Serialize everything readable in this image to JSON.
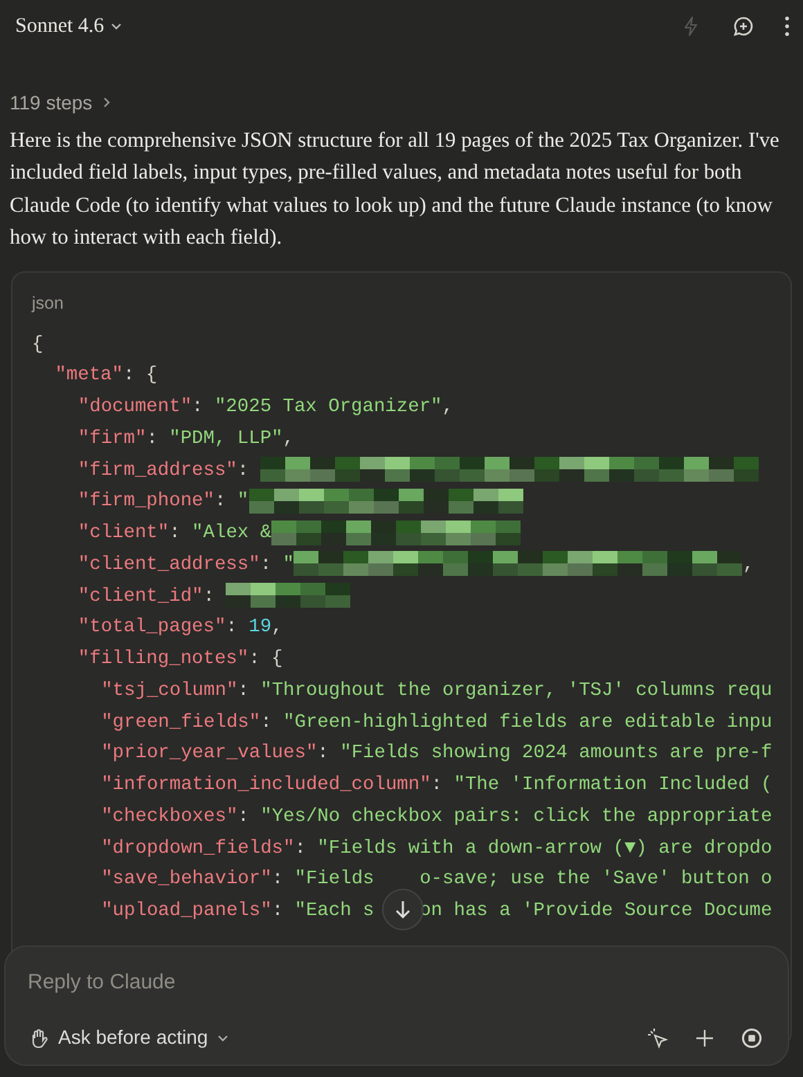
{
  "header": {
    "model": "Sonnet 4.6",
    "actions": [
      {
        "kind": "bolt",
        "disabled": true
      },
      {
        "kind": "new-chat",
        "disabled": false
      },
      {
        "kind": "more",
        "disabled": false
      }
    ]
  },
  "steps": {
    "label": "119 steps",
    "expanded": false
  },
  "message": "Here is the comprehensive JSON structure for all 19 pages of the 2025 Tax Organizer. I've included field labels, input types, pre-filled values, and metadata notes useful for both Claude Code (to identify what values to look up) and the future Claude instance (to know how to interact with each field).",
  "code_block": {
    "language": "json",
    "lines": [
      {
        "tokens": [
          {
            "kind": "punct",
            "text": "{"
          }
        ],
        "children": [
          {
            "tokens": [
              {
                "kind": "key",
                "text": "\"meta\""
              },
              {
                "kind": "punct",
                "text": ": {"
              }
            ],
            "children": [
              {
                "tokens": [
                  {
                    "kind": "key",
                    "text": "\"document\""
                  },
                  {
                    "kind": "punct",
                    "text": ": "
                  },
                  {
                    "kind": "string",
                    "text": "\"2025 Tax Organizer\""
                  },
                  {
                    "kind": "punct",
                    "text": ","
                  }
                ]
              },
              {
                "tokens": [
                  {
                    "kind": "key",
                    "text": "\"firm\""
                  },
                  {
                    "kind": "punct",
                    "text": ": "
                  },
                  {
                    "kind": "string",
                    "text": "\"PDM, LLP\""
                  },
                  {
                    "kind": "punct",
                    "text": ","
                  }
                ]
              },
              {
                "tokens": [
                  {
                    "kind": "key",
                    "text": "\"firm_address\""
                  },
                  {
                    "kind": "punct",
                    "text": ": "
                  },
                  {
                    "kind": "redacted"
                  }
                ]
              },
              {
                "tokens": [
                  {
                    "kind": "key",
                    "text": "\"firm_phone\""
                  },
                  {
                    "kind": "punct",
                    "text": ": "
                  },
                  {
                    "kind": "string",
                    "text": "\""
                  },
                  {
                    "kind": "redacted"
                  }
                ]
              },
              {
                "tokens": [
                  {
                    "kind": "key",
                    "text": "\"client\""
                  },
                  {
                    "kind": "punct",
                    "text": ": "
                  },
                  {
                    "kind": "string",
                    "text": "\"Alex &"
                  },
                  {
                    "kind": "redacted"
                  }
                ]
              },
              {
                "tokens": [
                  {
                    "kind": "key",
                    "text": "\"client_address\""
                  },
                  {
                    "kind": "punct",
                    "text": ": "
                  },
                  {
                    "kind": "string",
                    "text": "\""
                  },
                  {
                    "kind": "redacted"
                  },
                  {
                    "kind": "punct",
                    "text": ","
                  }
                ]
              },
              {
                "tokens": [
                  {
                    "kind": "key",
                    "text": "\"client_id\""
                  },
                  {
                    "kind": "punct",
                    "text": ": "
                  },
                  {
                    "kind": "redacted"
                  }
                ]
              },
              {
                "tokens": [
                  {
                    "kind": "key",
                    "text": "\"total_pages\""
                  },
                  {
                    "kind": "punct",
                    "text": ": "
                  },
                  {
                    "kind": "number",
                    "text": "19"
                  },
                  {
                    "kind": "punct",
                    "text": ","
                  }
                ]
              },
              {
                "tokens": [
                  {
                    "kind": "key",
                    "text": "\"filling_notes\""
                  },
                  {
                    "kind": "punct",
                    "text": ": {"
                  }
                ],
                "children": [
                  {
                    "tokens": [
                      {
                        "kind": "key",
                        "text": "\"tsj_column\""
                      },
                      {
                        "kind": "punct",
                        "text": ": "
                      },
                      {
                        "kind": "string",
                        "text": "\"Throughout the organizer, 'TSJ' columns requ"
                      }
                    ]
                  },
                  {
                    "tokens": [
                      {
                        "kind": "key",
                        "text": "\"green_fields\""
                      },
                      {
                        "kind": "punct",
                        "text": ": "
                      },
                      {
                        "kind": "string",
                        "text": "\"Green-highlighted fields are editable inpu"
                      }
                    ]
                  },
                  {
                    "tokens": [
                      {
                        "kind": "key",
                        "text": "\"prior_year_values\""
                      },
                      {
                        "kind": "punct",
                        "text": ": "
                      },
                      {
                        "kind": "string",
                        "text": "\"Fields showing 2024 amounts are pre-f"
                      }
                    ]
                  },
                  {
                    "tokens": [
                      {
                        "kind": "key",
                        "text": "\"information_included_column\""
                      },
                      {
                        "kind": "punct",
                        "text": ": "
                      },
                      {
                        "kind": "string",
                        "text": "\"The 'Information Included ("
                      }
                    ]
                  },
                  {
                    "tokens": [
                      {
                        "kind": "key",
                        "text": "\"checkboxes\""
                      },
                      {
                        "kind": "punct",
                        "text": ": "
                      },
                      {
                        "kind": "string",
                        "text": "\"Yes/No checkbox pairs: click the appropriate"
                      }
                    ]
                  },
                  {
                    "tokens": [
                      {
                        "kind": "key",
                        "text": "\"dropdown_fields\""
                      },
                      {
                        "kind": "punct",
                        "text": ": "
                      },
                      {
                        "kind": "string",
                        "text": "\"Fields with a down-arrow (▼) are dropdo"
                      }
                    ]
                  },
                  {
                    "tokens": [
                      {
                        "kind": "key",
                        "text": "\"save_behavior\""
                      },
                      {
                        "kind": "punct",
                        "text": ": "
                      },
                      {
                        "kind": "string",
                        "text": "\"Fields"
                      },
                      {
                        "kind": "covered"
                      },
                      {
                        "kind": "string",
                        "text": "o-save; use the 'Save' button o"
                      }
                    ]
                  },
                  {
                    "tokens": [
                      {
                        "kind": "key",
                        "text": "\"upload_panels\""
                      },
                      {
                        "kind": "punct",
                        "text": ": "
                      },
                      {
                        "kind": "string",
                        "text": "\"Each s"
                      },
                      {
                        "kind": "covered"
                      },
                      {
                        "kind": "string",
                        "text": "on has a 'Provide Source Docume"
                      }
                    ]
                  }
                ]
              }
            ]
          }
        ]
      }
    ]
  },
  "composer": {
    "placeholder": "Reply to Claude",
    "mode": "Ask before acting",
    "actions": [
      {
        "kind": "select-element"
      },
      {
        "kind": "add"
      },
      {
        "kind": "stop"
      }
    ]
  }
}
